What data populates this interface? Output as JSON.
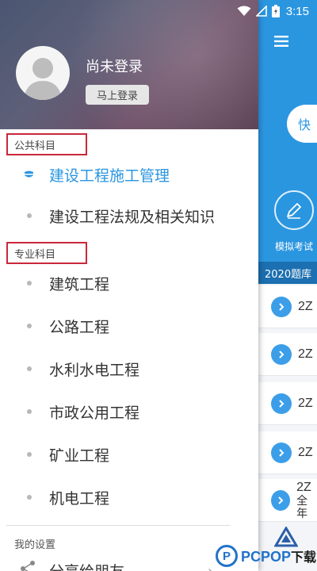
{
  "status_bar": {
    "time": "3:15"
  },
  "drawer": {
    "header": {
      "title": "尚未登录",
      "login_button": "马上登录"
    },
    "public_section": {
      "label": "公共科目",
      "items": [
        {
          "label": "建设工程施工管理",
          "active": true
        },
        {
          "label": "建设工程法规及相关知识",
          "active": false
        }
      ]
    },
    "professional_section": {
      "label": "专业科目",
      "items": [
        {
          "label": "建筑工程"
        },
        {
          "label": "公路工程"
        },
        {
          "label": "水利水电工程"
        },
        {
          "label": "市政公用工程"
        },
        {
          "label": "矿业工程"
        },
        {
          "label": "机电工程"
        }
      ]
    },
    "settings": {
      "label": "我的设置",
      "share_label": "分享给朋友"
    }
  },
  "background_app": {
    "pill_label": "快",
    "mock_exam_label": "模拟考试",
    "bank_bar_label": "2020题库",
    "rows": [
      {
        "text": "2Z"
      },
      {
        "text": "2Z"
      },
      {
        "text": "2Z"
      },
      {
        "text": "2Z"
      },
      {
        "text": "2Z",
        "subtext": "全年"
      }
    ]
  },
  "watermark": {
    "brand": "PCPOP",
    "suffix": "下载"
  },
  "colors": {
    "accent": "#2b96e0",
    "highlight_border": "#c9283b"
  }
}
